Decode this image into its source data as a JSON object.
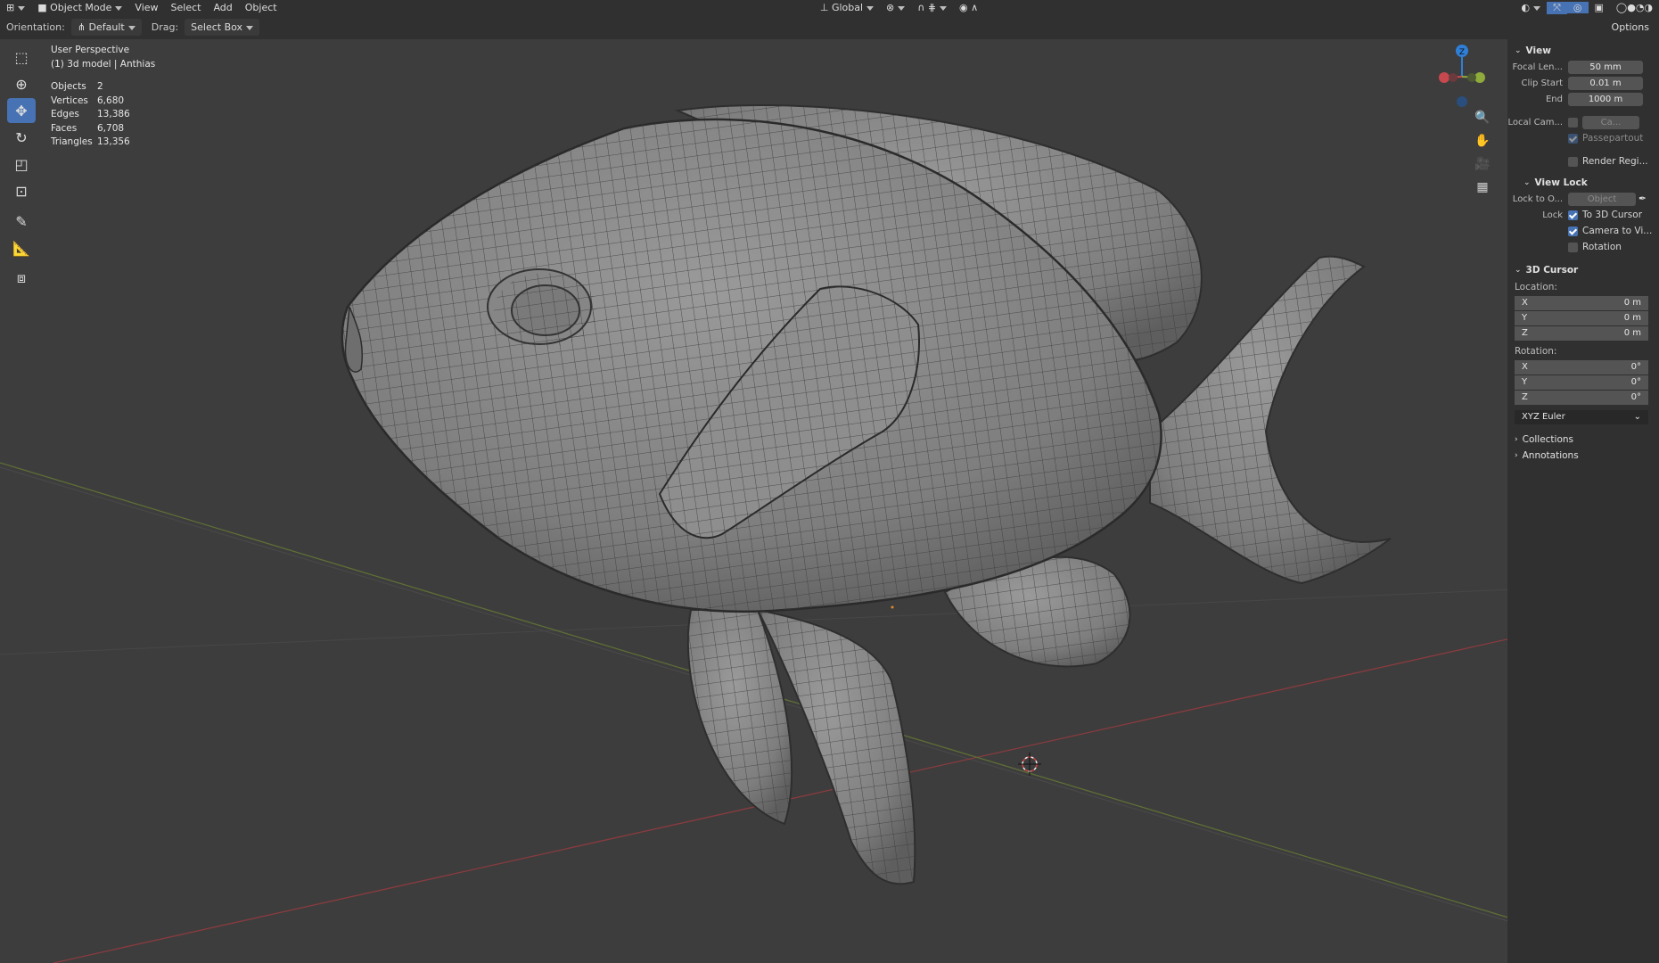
{
  "topbar": {
    "mode": "Object Mode",
    "menus": [
      "View",
      "Select",
      "Add",
      "Object"
    ],
    "transform_orientation": "Global",
    "options_label": "Options"
  },
  "tool_header": {
    "orientation_label": "Orientation:",
    "orientation_value": "Default",
    "drag_label": "Drag:",
    "drag_value": "Select Box"
  },
  "overlay": {
    "view_name": "User Perspective",
    "collection": "(1) 3d model | Anthias",
    "stats": [
      {
        "key": "Objects",
        "value": "2"
      },
      {
        "key": "Vertices",
        "value": "6,680"
      },
      {
        "key": "Edges",
        "value": "13,386"
      },
      {
        "key": "Faces",
        "value": "6,708"
      },
      {
        "key": "Triangles",
        "value": "13,356"
      }
    ]
  },
  "gizmo": {
    "z_label": "Z"
  },
  "sidebar": {
    "view": {
      "title": "View",
      "focal_label": "Focal Len...",
      "focal_value": "50 mm",
      "clip_start_label": "Clip Start",
      "clip_start_value": "0.01 m",
      "end_label": "End",
      "end_value": "1000 m",
      "local_cam_label": "Local Cam...",
      "local_cam_value": "Ca...",
      "passepartout": "Passepartout",
      "render_region": "Render Regi..."
    },
    "view_lock": {
      "title": "View Lock",
      "lock_to_label": "Lock to O...",
      "lock_to_value": "Object",
      "lock_label": "Lock",
      "to_cursor": "To 3D Cursor",
      "camera_to_view": "Camera to Vi...",
      "rotation": "Rotation"
    },
    "cursor": {
      "title": "3D Cursor",
      "location_label": "Location:",
      "location": [
        {
          "axis": "X",
          "value": "0 m"
        },
        {
          "axis": "Y",
          "value": "0 m"
        },
        {
          "axis": "Z",
          "value": "0 m"
        }
      ],
      "rotation_label": "Rotation:",
      "rotation": [
        {
          "axis": "X",
          "value": "0°"
        },
        {
          "axis": "Y",
          "value": "0°"
        },
        {
          "axis": "Z",
          "value": "0°"
        }
      ],
      "rotation_mode": "XYZ Euler"
    },
    "collections": "Collections",
    "annotations": "Annotations"
  },
  "colors": {
    "accent": "#4772b3",
    "x_axis": "#c8484f",
    "y_axis": "#8eab3c",
    "z_axis": "#2f7fd8"
  }
}
